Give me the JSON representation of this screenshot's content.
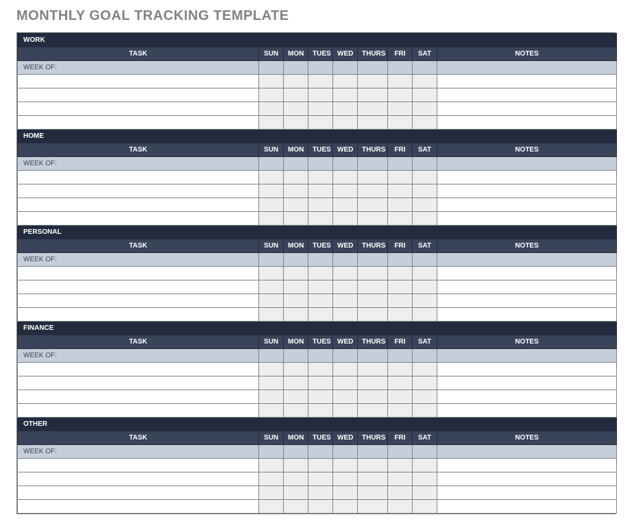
{
  "page_title": "MONTHLY GOAL TRACKING TEMPLATE",
  "columns": {
    "task": "TASK",
    "days": [
      "SUN",
      "MON",
      "TUES",
      "WED",
      "THURS",
      "FRI",
      "SAT"
    ],
    "notes": "NOTES"
  },
  "week_of_label": "WEEK OF:",
  "sections": [
    {
      "title": "WORK",
      "rows": [
        "",
        "",
        "",
        ""
      ]
    },
    {
      "title": "HOME",
      "rows": [
        "",
        "",
        "",
        ""
      ]
    },
    {
      "title": "PERSONAL",
      "rows": [
        "",
        "",
        "",
        ""
      ]
    },
    {
      "title": "FINANCE",
      "rows": [
        "",
        "",
        "",
        ""
      ]
    },
    {
      "title": "OTHER",
      "rows": [
        "",
        "",
        "",
        ""
      ]
    }
  ]
}
